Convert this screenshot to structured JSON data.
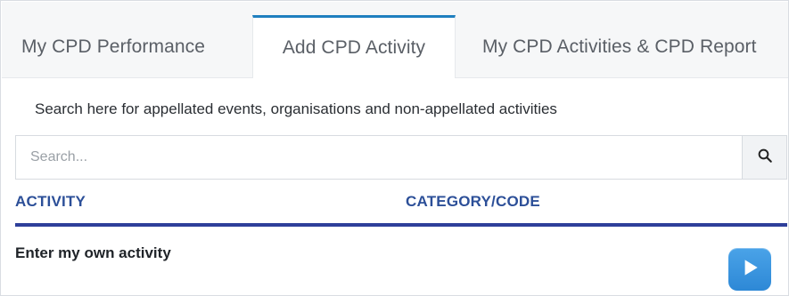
{
  "tabs": [
    {
      "label": "My CPD Performance",
      "active": false
    },
    {
      "label": "Add CPD Activity",
      "active": true
    },
    {
      "label": "My CPD Activities & CPD Report",
      "active": false
    }
  ],
  "help_text": "Search here for appellated events, organisations and non-appellated activities",
  "search": {
    "placeholder": "Search...",
    "value": "",
    "button_icon": "search-icon"
  },
  "table": {
    "headers": {
      "activity": "ACTIVITY",
      "category": "CATEGORY/CODE"
    },
    "rows": [
      {
        "label": "Enter my own activity",
        "action_icon": "play-icon"
      }
    ]
  },
  "colors": {
    "accent": "#1f7fbf",
    "header_text": "#2c4f98",
    "header_rule": "#2e3f9a",
    "play_button": "#3a95de"
  }
}
